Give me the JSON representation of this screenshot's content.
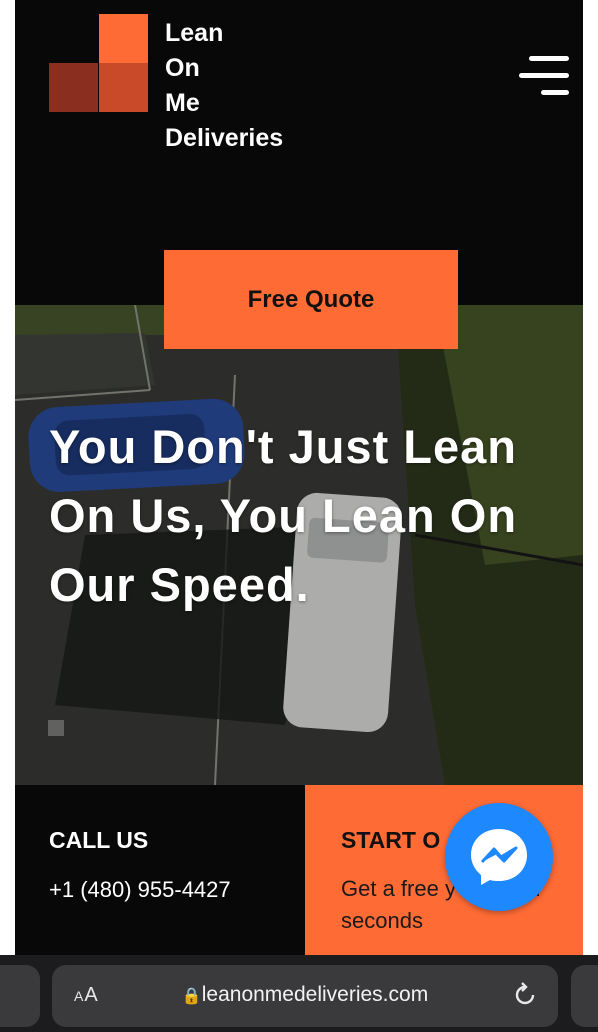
{
  "header": {
    "brand_name": "Lean\nOn\nMe\nDeliveries",
    "menu_icon": "hamburger-menu-icon",
    "free_quote_label": "Free Quote"
  },
  "hero": {
    "headline": "You Don't Just Lean On Us, You Lean On Our Speed."
  },
  "contact": {
    "call_title": "CALL US",
    "phone": "+1 (480) 955-4427",
    "start_title": "START O",
    "start_desc": "Get a free       y quote in seconds"
  },
  "messenger": {
    "icon": "messenger-chat-icon",
    "color": "#1e88ff"
  },
  "browser": {
    "text_size_label": "AA",
    "url": "leanonmedeliveries.com",
    "reload_icon": "reload-icon"
  },
  "colors": {
    "accent": "#ff6b35",
    "background": "#080808"
  }
}
